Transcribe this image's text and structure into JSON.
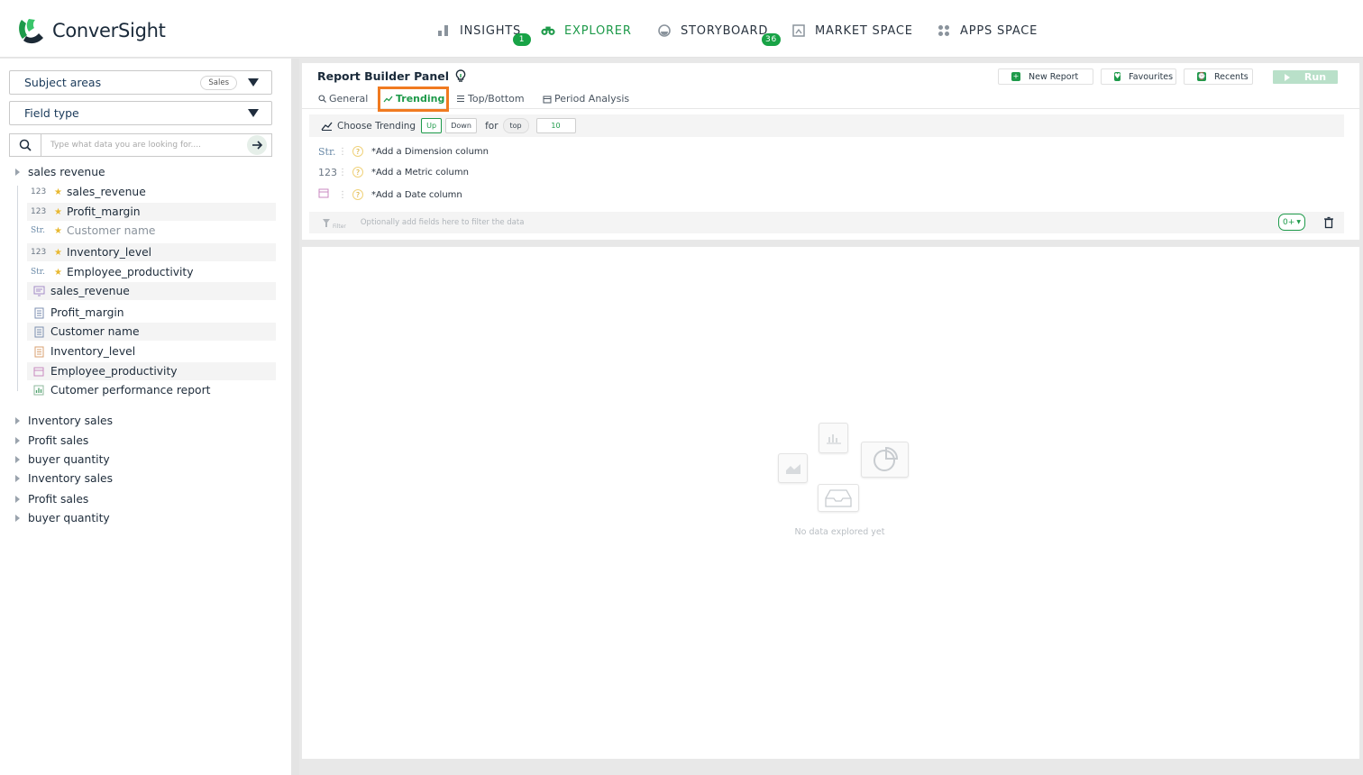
{
  "brand": {
    "name": "ConverSight",
    "accent": "#1e9a4a"
  },
  "nav": [
    {
      "label": "INSIGHTS",
      "icon": "bar-chart-icon",
      "badge": "1"
    },
    {
      "label": "EXPLORER",
      "icon": "binoculars-icon",
      "active": true
    },
    {
      "label": "STORYBOARD",
      "icon": "palette-icon",
      "badge": "36"
    },
    {
      "label": "MARKET SPACE",
      "icon": "market-icon"
    },
    {
      "label": "APPS SPACE",
      "icon": "apps-grid-icon"
    }
  ],
  "sidebar": {
    "subject_areas": {
      "label": "Subject areas",
      "pill": "Sales"
    },
    "field_type": {
      "label": "Field type"
    },
    "search": {
      "placeholder": "Type what data you are looking for...."
    },
    "tree_root": "sales revenue",
    "fields": [
      {
        "type": "123",
        "star": true,
        "label": "sales_revenue"
      },
      {
        "type": "123",
        "star": true,
        "label": "Profit_margin"
      },
      {
        "type": "Str.",
        "star": true,
        "label": "Customer name",
        "muted": true
      },
      {
        "type": "123",
        "star": true,
        "label": "Inventory_level"
      },
      {
        "type": "Str.",
        "star": true,
        "label": "Employee_productivity"
      },
      {
        "icon": "monitor-doc-icon",
        "label": "sales_revenue"
      },
      {
        "icon": "doc-icon",
        "label": "Profit_margin"
      },
      {
        "icon": "doc-icon",
        "label": "Customer name"
      },
      {
        "icon": "doc-orange-icon",
        "label": "Inventory_level"
      },
      {
        "icon": "calendar-doc-icon",
        "label": "Employee_productivity"
      },
      {
        "icon": "chart-doc-icon",
        "label": "Cutomer performance report"
      }
    ],
    "groups": [
      "Inventory sales",
      "Profit sales",
      "buyer quantity",
      "Inventory sales",
      "Profit sales",
      "buyer quantity"
    ]
  },
  "panel": {
    "title": "Report Builder Panel",
    "buttons": {
      "new_report": "New Report",
      "favourites": "Favourites",
      "recents": "Recents",
      "run": "Run"
    },
    "tabs": [
      "General",
      "Trending",
      "Top/Bottom",
      "Period Analysis"
    ],
    "trending": {
      "label": "Choose Trending",
      "up": "Up",
      "down": "Down",
      "for": "for",
      "top": "top",
      "count": "10"
    },
    "columns": [
      {
        "type": "Str.",
        "label": "*Add a Dimension column"
      },
      {
        "type": "123",
        "label": "*Add a Metric column"
      },
      {
        "type": "date",
        "label": "*Add a Date column"
      }
    ],
    "filter": {
      "label": "Filter",
      "placeholder": "Optionally add fields here to filter the data",
      "count": "0+"
    }
  },
  "result": {
    "empty_text": "No data explored yet"
  }
}
